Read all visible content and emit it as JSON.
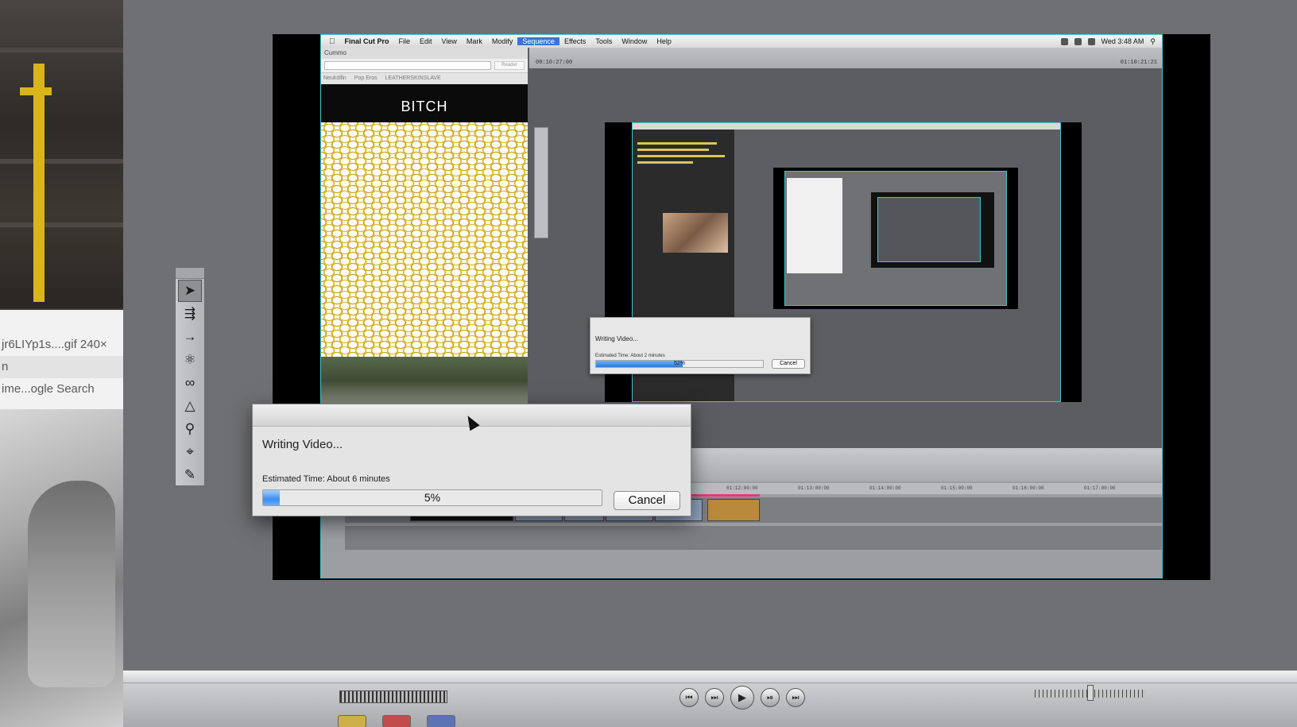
{
  "left_panel": {
    "rows": [
      "jr6LIYp1s....gif 240×",
      "n",
      "ime...ogle Search"
    ]
  },
  "menubar": {
    "app": "Final Cut Pro",
    "items": [
      "File",
      "Edit",
      "View",
      "Mark",
      "Modify",
      "Sequence",
      "Effects",
      "Tools",
      "Window",
      "Help"
    ],
    "active": "Sequence",
    "clock": "Wed 3:48 AM"
  },
  "browser": {
    "tab": "Cummo",
    "reader": "Reader",
    "bookmarks": [
      "Neuköllln",
      "Pop Eros",
      "LEATHERSKINSLAVE"
    ],
    "site_header": "BITCH"
  },
  "canvas": {
    "timecode_left": "00:10:27:00",
    "timecode_right": "01:10:21:21"
  },
  "nested_dialog": {
    "title": "Writing Video...",
    "estimate": "Estimated Time: About 2 minutes",
    "percent": "52%",
    "progress": 0.52,
    "cancel": "Cancel"
  },
  "timeline": {
    "ruler": [
      "01:12:00:00",
      "01:13:00:00",
      "01:14:00:00",
      "01:15:00:00",
      "01:16:00:00",
      "01:17:00:00"
    ]
  },
  "dialog": {
    "title": "Writing Video...",
    "estimate": "Estimated Time: About 6 minutes",
    "percent": "5%",
    "progress": 0.05,
    "cancel": "Cancel"
  },
  "tools": [
    "selection-arrow",
    "track-select",
    "ripple-edit",
    "roll-edit",
    "slip-edit",
    "razor-blade",
    "zoom",
    "crop",
    "pen"
  ],
  "colors": {
    "accent_cyan": "#3ec7cf",
    "menu_highlight": "#3b73d9",
    "progress_blue": "#3d8ef0"
  }
}
